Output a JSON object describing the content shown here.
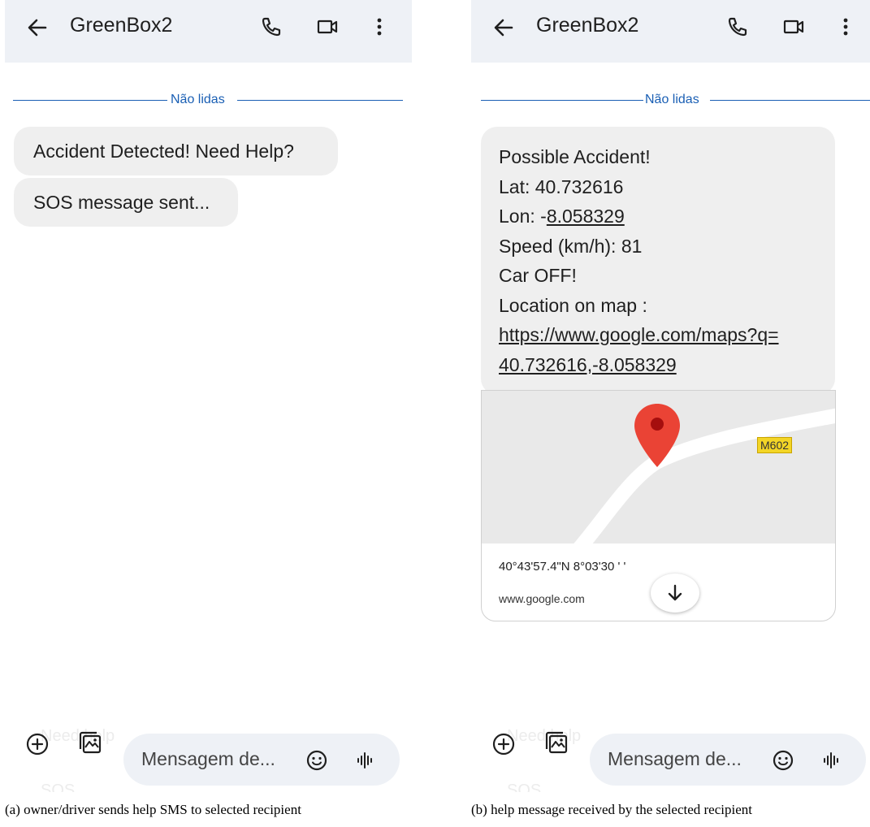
{
  "panels": [
    {
      "contact_name": "GreenBox2",
      "divider_label": "Não lidas",
      "messages": [
        {
          "text": "Accident Detected! Need Help?"
        },
        {
          "text": "SOS message sent..."
        }
      ],
      "composer": {
        "placeholder": "Mensagem de...",
        "ghost_text": "Need help",
        "ghost_text_2": "SOS"
      },
      "caption": "(a) owner/driver sends help SMS to selected recipient"
    },
    {
      "contact_name": "GreenBox2",
      "divider_label": "Não lidas",
      "message": {
        "line1": "Possible Accident!",
        "line2": "Lat: 40.732616",
        "lon_prefix": "Lon: -",
        "lon_value": "8.058329",
        "line4": "Speed (km/h): 81",
        "line5": "Car OFF!",
        "line6": "Location on map :",
        "link_line1": "https://www.google.com/maps?q=",
        "link_line2": "40.732616,-8.058329"
      },
      "link_preview": {
        "road_label": "M602",
        "coords": "40°43'57.4\"N 8°03'30 ",
        "coords_tail": "' '",
        "site": "www.google.com"
      },
      "composer": {
        "placeholder": "Mensagem de...",
        "ghost_text": "Need help",
        "ghost_text_2": "SOS"
      },
      "caption": "(b) help message received by the selected recipient"
    }
  ],
  "icons": {
    "back": "arrow-left",
    "call": "phone",
    "video": "video-camera",
    "menu": "more-vertical",
    "attach": "plus-circle",
    "gallery": "image-gallery",
    "emoji": "smiley",
    "voice": "waveform",
    "scroll_down": "arrow-down",
    "map_pin": "map-pin"
  },
  "colors": {
    "topbar_bg": "#eef1f6",
    "bubble_bg": "#efefef",
    "divider": "#1a5fb4",
    "pin": "#ea4335",
    "road_label_bg": "#f3d526"
  }
}
